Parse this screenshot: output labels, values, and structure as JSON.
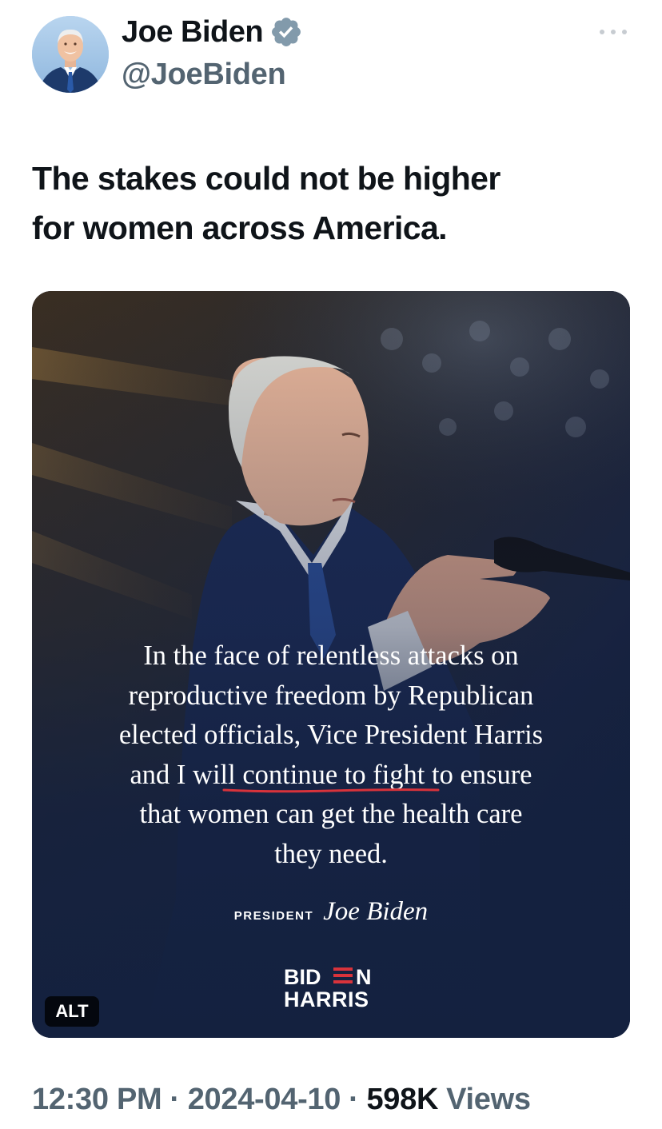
{
  "author": {
    "display_name": "Joe Biden",
    "handle": "@JoeBiden",
    "verified": true,
    "verified_icon": "verified-badge-icon",
    "verified_color": "#829aab"
  },
  "more_icon": "more-horizontal-icon",
  "tweet": {
    "text_line1": "The stakes could not be higher",
    "text_line2": "for women across America."
  },
  "media": {
    "quote_lines": [
      "In the face of relentless attacks on",
      "reproductive freedom by Republican",
      "elected officials, Vice President Harris",
      "and I will continue to fight to ensure",
      "that women can get the health care",
      "they need."
    ],
    "signature_title": "PRESIDENT",
    "signature_name": "Joe Biden",
    "logo_line1": "BIDEN",
    "logo_line2": "HARRIS",
    "alt_label": "ALT",
    "background_color": "#14213f",
    "underline_color": "#d8333b"
  },
  "meta": {
    "time": "12:30 PM",
    "separator": "·",
    "date": "2024-04-10",
    "views_count": "598K",
    "views_label": "Views"
  }
}
